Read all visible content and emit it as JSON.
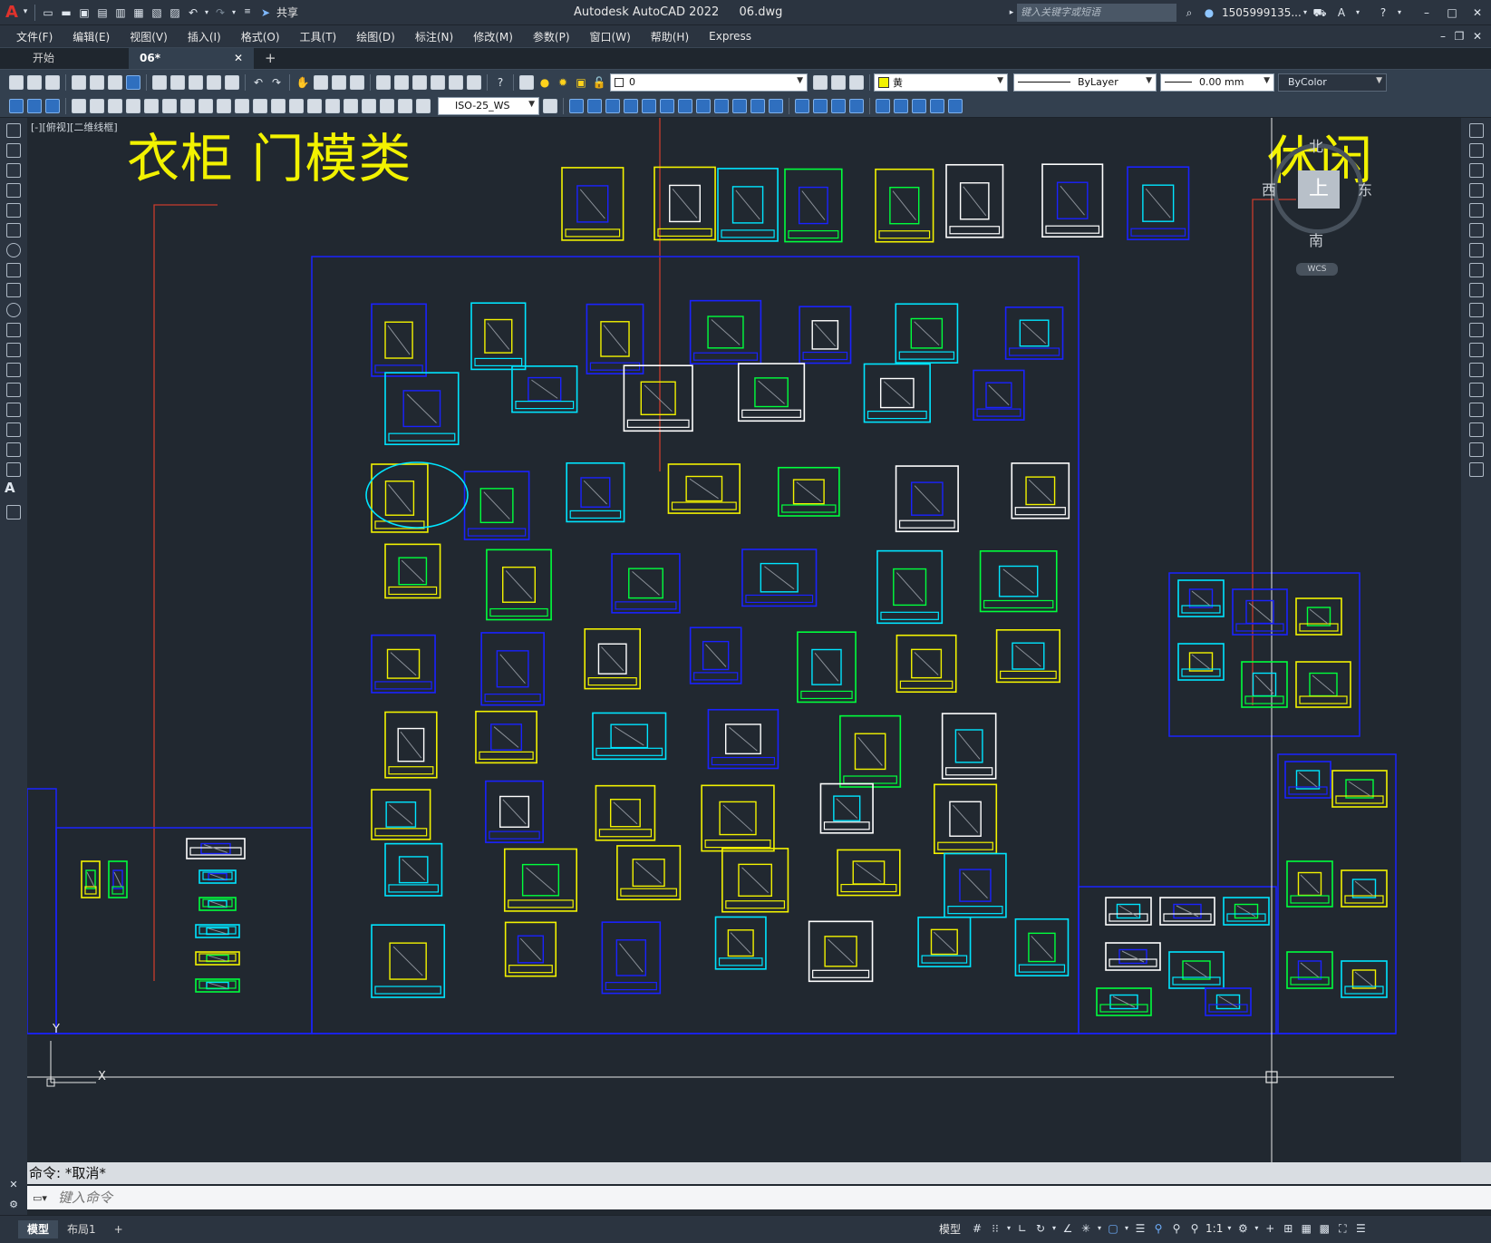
{
  "app": {
    "title": "Autodesk AutoCAD 2022",
    "file": "06.dwg",
    "share_label": "共享",
    "search_placeholder": "键入关键字或短语",
    "user": "1505999135...",
    "logo_letter": "A"
  },
  "menu": [
    "文件(F)",
    "编辑(E)",
    "视图(V)",
    "插入(I)",
    "格式(O)",
    "工具(T)",
    "绘图(D)",
    "标注(N)",
    "修改(M)",
    "参数(P)",
    "窗口(W)",
    "帮助(H)",
    "Express"
  ],
  "tabs": [
    {
      "label": "开始",
      "active": false
    },
    {
      "label": "06*",
      "active": true
    }
  ],
  "toolbar": {
    "layer_value": "0",
    "color_value": "黄",
    "linetype_value": "ByLayer",
    "lineweight_value": "0.00 mm",
    "plotstyle_value": "ByColor",
    "dimstyle_value": "ISO-25_WS"
  },
  "viewport": {
    "label": "[-][俯视][二维线框]",
    "title_left": "衣柜 门模类",
    "title_right": "休闲",
    "viewcube": {
      "top": "上",
      "north": "北",
      "south": "南",
      "east": "东",
      "west": "西",
      "wcs": "WCS"
    },
    "ucs_x": "X",
    "ucs_y": "Y"
  },
  "command": {
    "history": "命令:  *取消*",
    "input_placeholder": "键入命令"
  },
  "status": {
    "layout_tabs": [
      {
        "label": "模型",
        "active": true
      },
      {
        "label": "布局1",
        "active": false
      }
    ],
    "add_tab": "+",
    "model_label": "模型",
    "scale": "1:1"
  },
  "colors": {
    "accent_yellow": "#f2f200",
    "cad_blue": "#1a22ff",
    "cad_cyan": "#00e5ff",
    "cad_green": "#00ff3c",
    "background": "#212830"
  }
}
